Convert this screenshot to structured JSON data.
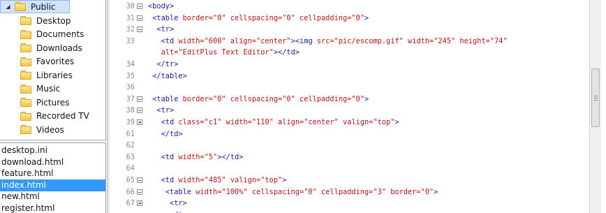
{
  "tree": {
    "head": "Public",
    "items": [
      "Desktop",
      "Documents",
      "Downloads",
      "Favorites",
      "Libraries",
      "Music",
      "Pictures",
      "Recorded TV",
      "Videos"
    ]
  },
  "files": [
    "desktop.ini",
    "download.html",
    "feature.html",
    "index.html",
    "new.html",
    "register.html"
  ],
  "selected_file": "index.html",
  "editor": {
    "lines": [
      {
        "n": "30",
        "fold": "minus",
        "html": [
          [
            "t",
            "<body>"
          ]
        ]
      },
      {
        "n": "31",
        "fold": "minus",
        "html": [
          [
            "p",
            " "
          ],
          [
            "t",
            "<table "
          ],
          [
            "a",
            "border="
          ],
          [
            "v",
            "\"0\""
          ],
          [
            "a",
            " cellspacing="
          ],
          [
            "v",
            "\"0\""
          ],
          [
            "a",
            " cellpadding="
          ],
          [
            "v",
            "\"0\""
          ],
          [
            "t",
            ">"
          ]
        ]
      },
      {
        "n": "32",
        "fold": "minus",
        "html": [
          [
            "p",
            "  "
          ],
          [
            "t",
            "<tr>"
          ]
        ]
      },
      {
        "n": "33",
        "fold": "",
        "html": [
          [
            "p",
            "   "
          ],
          [
            "t",
            "<td "
          ],
          [
            "a",
            "width="
          ],
          [
            "v",
            "\"600\""
          ],
          [
            "a",
            " align="
          ],
          [
            "v",
            "\"center\""
          ],
          [
            "t",
            ">"
          ],
          [
            "t",
            "<img "
          ],
          [
            "a",
            "src="
          ],
          [
            "v",
            "\"pic/escomp.gif\""
          ],
          [
            "a",
            " width="
          ],
          [
            "v",
            "\"245\""
          ],
          [
            "a",
            " height="
          ],
          [
            "v",
            "\"74\""
          ]
        ]
      },
      {
        "n": "",
        "fold": "",
        "html": [
          [
            "p",
            "   "
          ],
          [
            "a",
            "alt="
          ],
          [
            "v",
            "\"EditPlus Text Editor\""
          ],
          [
            "t",
            ">"
          ],
          [
            "t",
            "</td>"
          ]
        ]
      },
      {
        "n": "34",
        "fold": "",
        "html": [
          [
            "p",
            "  "
          ],
          [
            "t",
            "</tr>"
          ]
        ]
      },
      {
        "n": "35",
        "fold": "",
        "html": [
          [
            "p",
            " "
          ],
          [
            "t",
            "</table>"
          ]
        ]
      },
      {
        "n": "36",
        "fold": "",
        "html": []
      },
      {
        "n": "37",
        "fold": "minus",
        "html": [
          [
            "p",
            " "
          ],
          [
            "t",
            "<table "
          ],
          [
            "a",
            "border="
          ],
          [
            "v",
            "\"0\""
          ],
          [
            "a",
            " cellspacing="
          ],
          [
            "v",
            "\"0\""
          ],
          [
            "a",
            " cellpadding="
          ],
          [
            "v",
            "\"0\""
          ],
          [
            "t",
            ">"
          ]
        ]
      },
      {
        "n": "38",
        "fold": "minus",
        "html": [
          [
            "p",
            "  "
          ],
          [
            "t",
            "<tr>"
          ]
        ]
      },
      {
        "n": "39",
        "fold": "plus",
        "html": [
          [
            "p",
            "   "
          ],
          [
            "t",
            "<td "
          ],
          [
            "a",
            "class="
          ],
          [
            "v",
            "\"c1\""
          ],
          [
            "a",
            " width="
          ],
          [
            "v",
            "\"110\""
          ],
          [
            "a",
            " align="
          ],
          [
            "v",
            "\"center\""
          ],
          [
            "a",
            " valign="
          ],
          [
            "v",
            "\"top\""
          ],
          [
            "t",
            ">"
          ]
        ]
      },
      {
        "n": "61",
        "fold": "",
        "html": [
          [
            "p",
            "   "
          ],
          [
            "t",
            "</td>"
          ]
        ]
      },
      {
        "n": "62",
        "fold": "",
        "html": []
      },
      {
        "n": "63",
        "fold": "",
        "html": [
          [
            "p",
            "   "
          ],
          [
            "t",
            "<td "
          ],
          [
            "a",
            "width="
          ],
          [
            "v",
            "\"5\""
          ],
          [
            "t",
            ">"
          ],
          [
            "t",
            "</td>"
          ]
        ]
      },
      {
        "n": "64",
        "fold": "",
        "html": []
      },
      {
        "n": "65",
        "fold": "minus",
        "html": [
          [
            "p",
            "   "
          ],
          [
            "t",
            "<td "
          ],
          [
            "a",
            "width="
          ],
          [
            "v",
            "\"485\""
          ],
          [
            "a",
            " valign="
          ],
          [
            "v",
            "\"top\""
          ],
          [
            "t",
            ">"
          ]
        ]
      },
      {
        "n": "66",
        "fold": "minus",
        "html": [
          [
            "p",
            "    "
          ],
          [
            "t",
            "<table "
          ],
          [
            "a",
            "width="
          ],
          [
            "v",
            "\"100%\""
          ],
          [
            "a",
            " cellspacing="
          ],
          [
            "v",
            "\"0\""
          ],
          [
            "a",
            " cellpadding="
          ],
          [
            "v",
            "\"3\""
          ],
          [
            "a",
            " border="
          ],
          [
            "v",
            "\"0\""
          ],
          [
            "t",
            ">"
          ]
        ]
      },
      {
        "n": "67",
        "fold": "plus",
        "html": [
          [
            "p",
            "     "
          ],
          [
            "t",
            "<tr>"
          ]
        ]
      },
      {
        "n": "",
        "fold": "",
        "html": [
          [
            "p",
            "     "
          ],
          [
            "t",
            "</tr>"
          ]
        ]
      }
    ]
  },
  "colors": {
    "tag": "#1a1aa8",
    "attr": "#c01515",
    "selection": "#3399ff"
  }
}
